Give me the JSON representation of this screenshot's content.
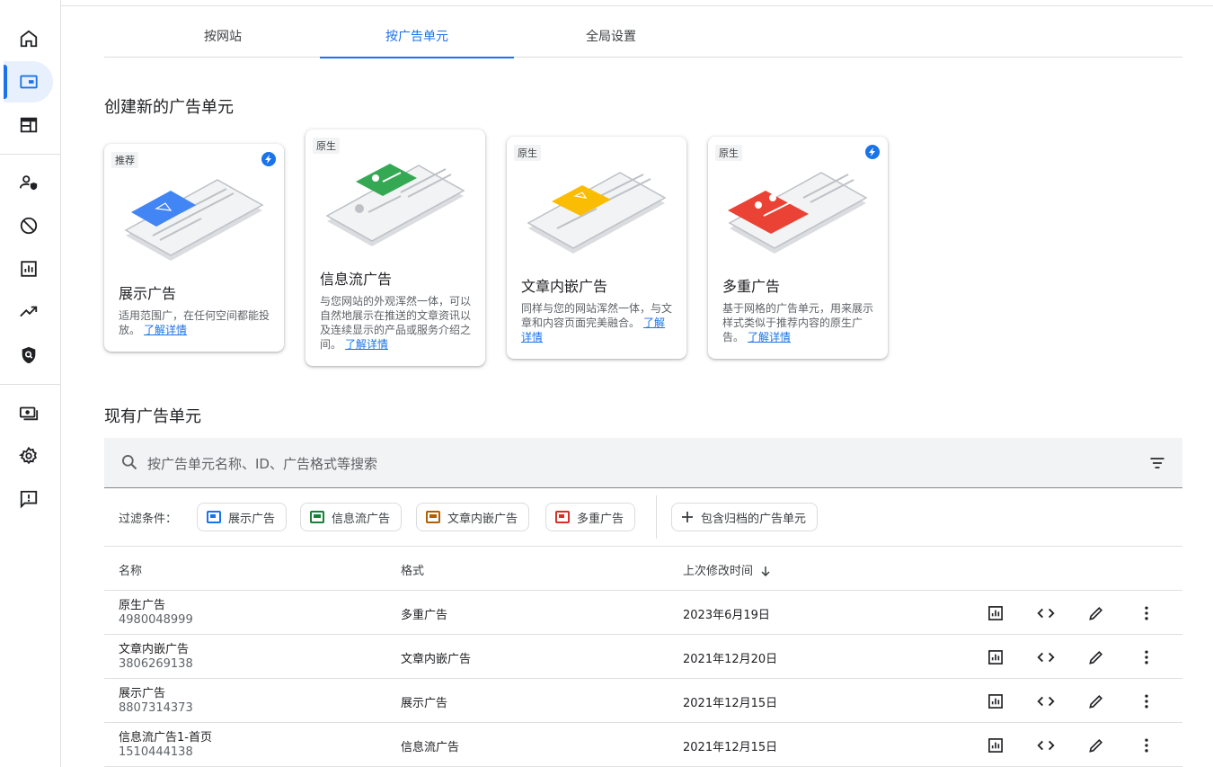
{
  "nav": {
    "items": [
      {
        "icon": "home-icon"
      },
      {
        "icon": "ad-unit-icon",
        "active": true
      },
      {
        "icon": "layout-icon"
      },
      {
        "icon": "user-shield-icon"
      },
      {
        "icon": "block-icon"
      },
      {
        "icon": "report-icon"
      },
      {
        "icon": "trending-icon"
      },
      {
        "icon": "privacy-icon"
      },
      {
        "icon": "payments-icon"
      },
      {
        "icon": "settings-icon"
      },
      {
        "icon": "feedback-icon"
      }
    ]
  },
  "tabs": [
    "按网站",
    "按广告单元",
    "全局设置"
  ],
  "create_section": {
    "title": "创建新的广告单元",
    "cards": [
      {
        "badge": "推荐",
        "title": "展示广告",
        "desc": "适用范围广，在任何空间都能投放。",
        "link": "了解详情",
        "color": "#4285f4"
      },
      {
        "badge": "原生",
        "title": "信息流广告",
        "desc": "与您网站的外观浑然一体，可以自然地展示在推送的文章资讯以及连续显示的产品或服务介绍之间。",
        "link": "了解详情",
        "color": "#34a853"
      },
      {
        "badge": "原生",
        "title": "文章内嵌广告",
        "desc": "同样与您的网站浑然一体，与文章和内容页面完美融合。",
        "link": "了解详情",
        "color": "#fbbc04"
      },
      {
        "badge": "原生",
        "title": "多重广告",
        "desc": "基于网格的广告单元，用来展示样式类似于推荐内容的原生广告。",
        "link": "了解详情",
        "color": "#ea4335"
      }
    ]
  },
  "existing_section": {
    "title": "现有广告单元",
    "search_placeholder": "按广告单元名称、ID、广告格式等搜索",
    "filter_label": "过滤条件：",
    "filter_chips": [
      {
        "label": "展示广告",
        "color": "#1a73e8"
      },
      {
        "label": "信息流广告",
        "color": "#188038"
      },
      {
        "label": "文章内嵌广告",
        "color": "#b06000"
      },
      {
        "label": "多重广告",
        "color": "#d93025"
      }
    ],
    "archive_chip": "包含归档的广告单元",
    "columns": {
      "name": "名称",
      "format": "格式",
      "modified": "上次修改时间"
    },
    "rows": [
      {
        "name": "原生广告",
        "id": "4980048999",
        "format": "多重广告",
        "date": "2023年6月19日"
      },
      {
        "name": "文章内嵌广告",
        "id": "3806269138",
        "format": "文章内嵌广告",
        "date": "2021年12月20日"
      },
      {
        "name": "展示广告",
        "id": "8807314373",
        "format": "展示广告",
        "date": "2021年12月15日"
      },
      {
        "name": "信息流广告1-首页",
        "id": "1510444138",
        "format": "信息流广告",
        "date": "2021年12月15日"
      }
    ]
  }
}
